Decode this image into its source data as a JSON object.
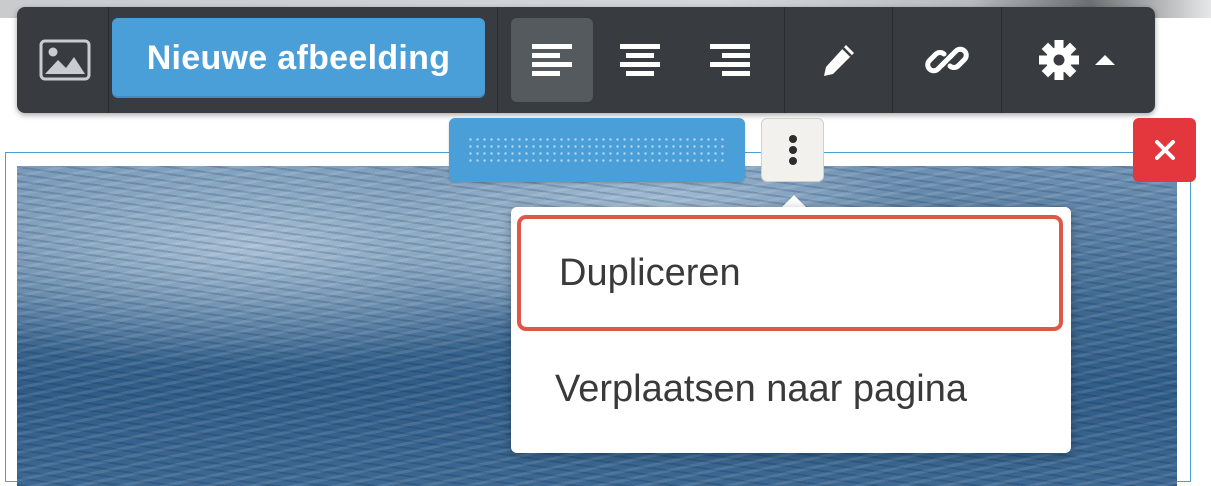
{
  "toolbar": {
    "image_icon": "image-icon",
    "new_image_label": "Nieuwe afbeelding",
    "align_left_icon": "align-left-icon",
    "align_center_icon": "align-center-icon",
    "align_right_icon": "align-right-icon",
    "edit_icon": "pencil-icon",
    "link_icon": "link-icon",
    "settings_icon": "gear-icon",
    "settings_caret_icon": "caret-up-icon",
    "active_alignment": "left"
  },
  "block_controls": {
    "drag_handle_icon": "drag-handle",
    "more_icon": "vertical-ellipsis-icon",
    "close_label": "×"
  },
  "context_menu": {
    "items": [
      {
        "label": "Dupliceren",
        "highlighted": true
      },
      {
        "label": "Verplaatsen naar pagina",
        "highlighted": false
      }
    ]
  },
  "colors": {
    "toolbar_bg": "#383c40",
    "accent_blue": "#4a9fd8",
    "close_red": "#e3363d",
    "highlight_outline": "#e0574a"
  }
}
